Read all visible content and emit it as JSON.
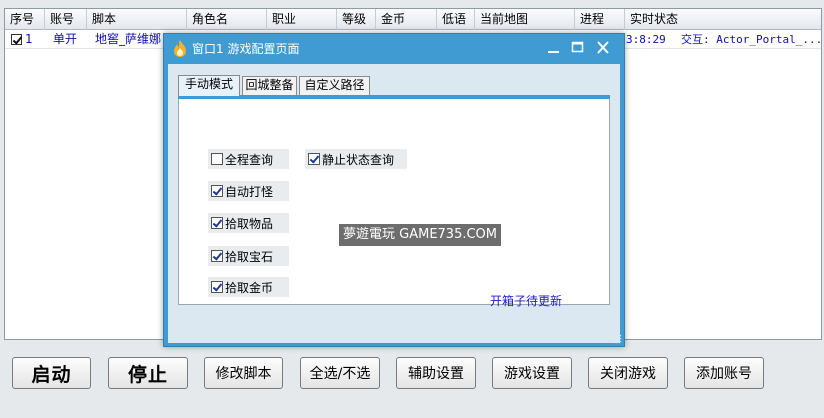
{
  "grid": {
    "columns": [
      "序号",
      "账号",
      "脚本",
      "角色名",
      "职业",
      "等级",
      "金币",
      "低语",
      "当前地图",
      "进程",
      "实时状态"
    ],
    "rows": [
      {
        "checked": true,
        "index": "1",
        "account": "单开",
        "script": "地窖_萨维娜",
        "time": "3:8:29",
        "status": "交互: Actor_Portal_..."
      }
    ]
  },
  "buttons": {
    "start": "启动",
    "stop": "停止",
    "edit_script": "修改脚本",
    "select_all": "全选/不选",
    "assist": "辅助设置",
    "game_settings": "游戏设置",
    "close_game": "关闭游戏",
    "add_account": "添加账号"
  },
  "dialog": {
    "title": "窗口1 游戏配置页面",
    "tabs": [
      "手动模式",
      "回城整备",
      "自定义路径"
    ],
    "options": [
      {
        "label": "全程查询",
        "checked": false
      },
      {
        "label": "静止状态查询",
        "checked": true
      },
      {
        "label": "自动打怪",
        "checked": true
      },
      {
        "label": "拾取物品",
        "checked": true
      },
      {
        "label": "拾取宝石",
        "checked": true
      },
      {
        "label": "拾取金币",
        "checked": true
      }
    ],
    "watermark": "夢遊電玩 GAME735.COM",
    "pending_note": "开箱子待更新"
  },
  "colors": {
    "dialog_frame": "#3f9bd1",
    "grid_text": "#1010a8",
    "link": "#1a1acb"
  }
}
